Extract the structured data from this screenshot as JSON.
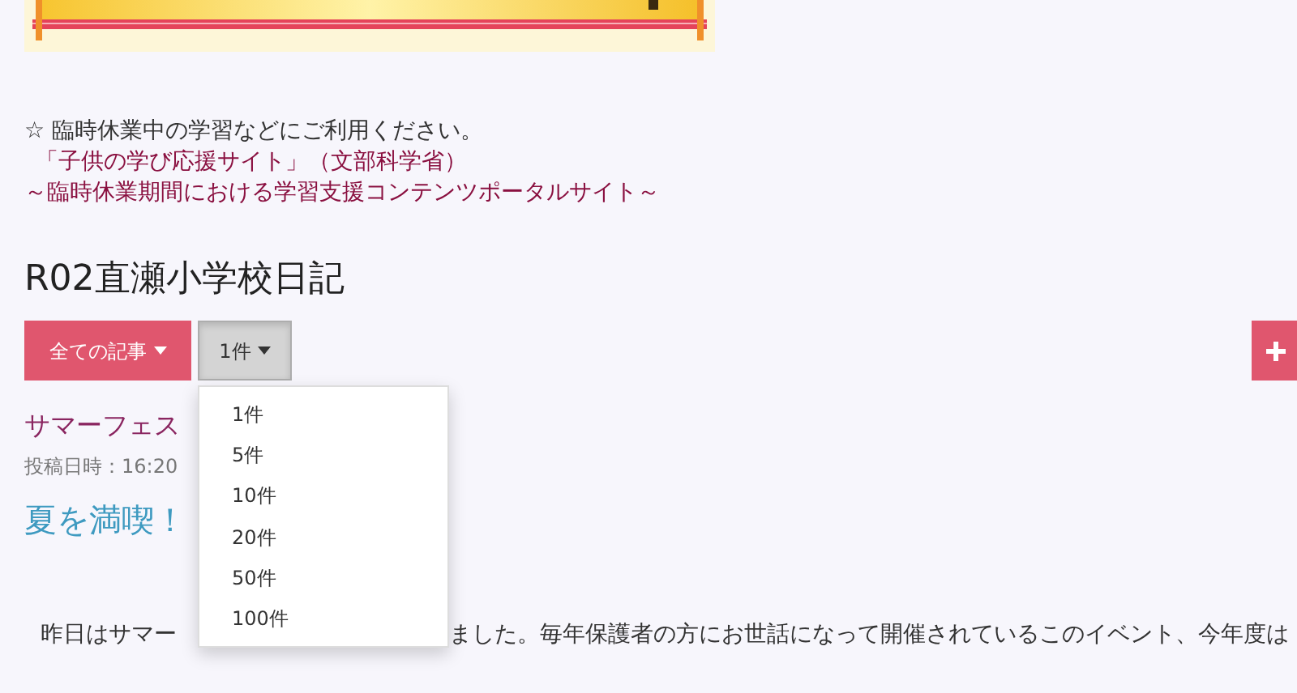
{
  "notice": {
    "line": "☆ 臨時休業中の学習などにご利用ください。",
    "links": [
      "「子供の学び応援サイト」（文部科学省）",
      "～臨時休業期間における学習支援コンテンツポータルサイト～"
    ]
  },
  "page_title": "R02直瀬小学校日記",
  "toolbar": {
    "category_button": "全ての記事",
    "count_dropdown": {
      "label": "1件",
      "open": true,
      "options": [
        "1件",
        "5件",
        "10件",
        "20件",
        "50件",
        "100件"
      ]
    }
  },
  "article": {
    "title": "サマーフェス",
    "meta": "投稿日時：16:20",
    "heading": "夏を満喫！",
    "body": [
      "昨日はサマー",
      "ました。毎年保護者の方にお世話になって開催されているこのイベント、今年度は"
    ]
  }
}
